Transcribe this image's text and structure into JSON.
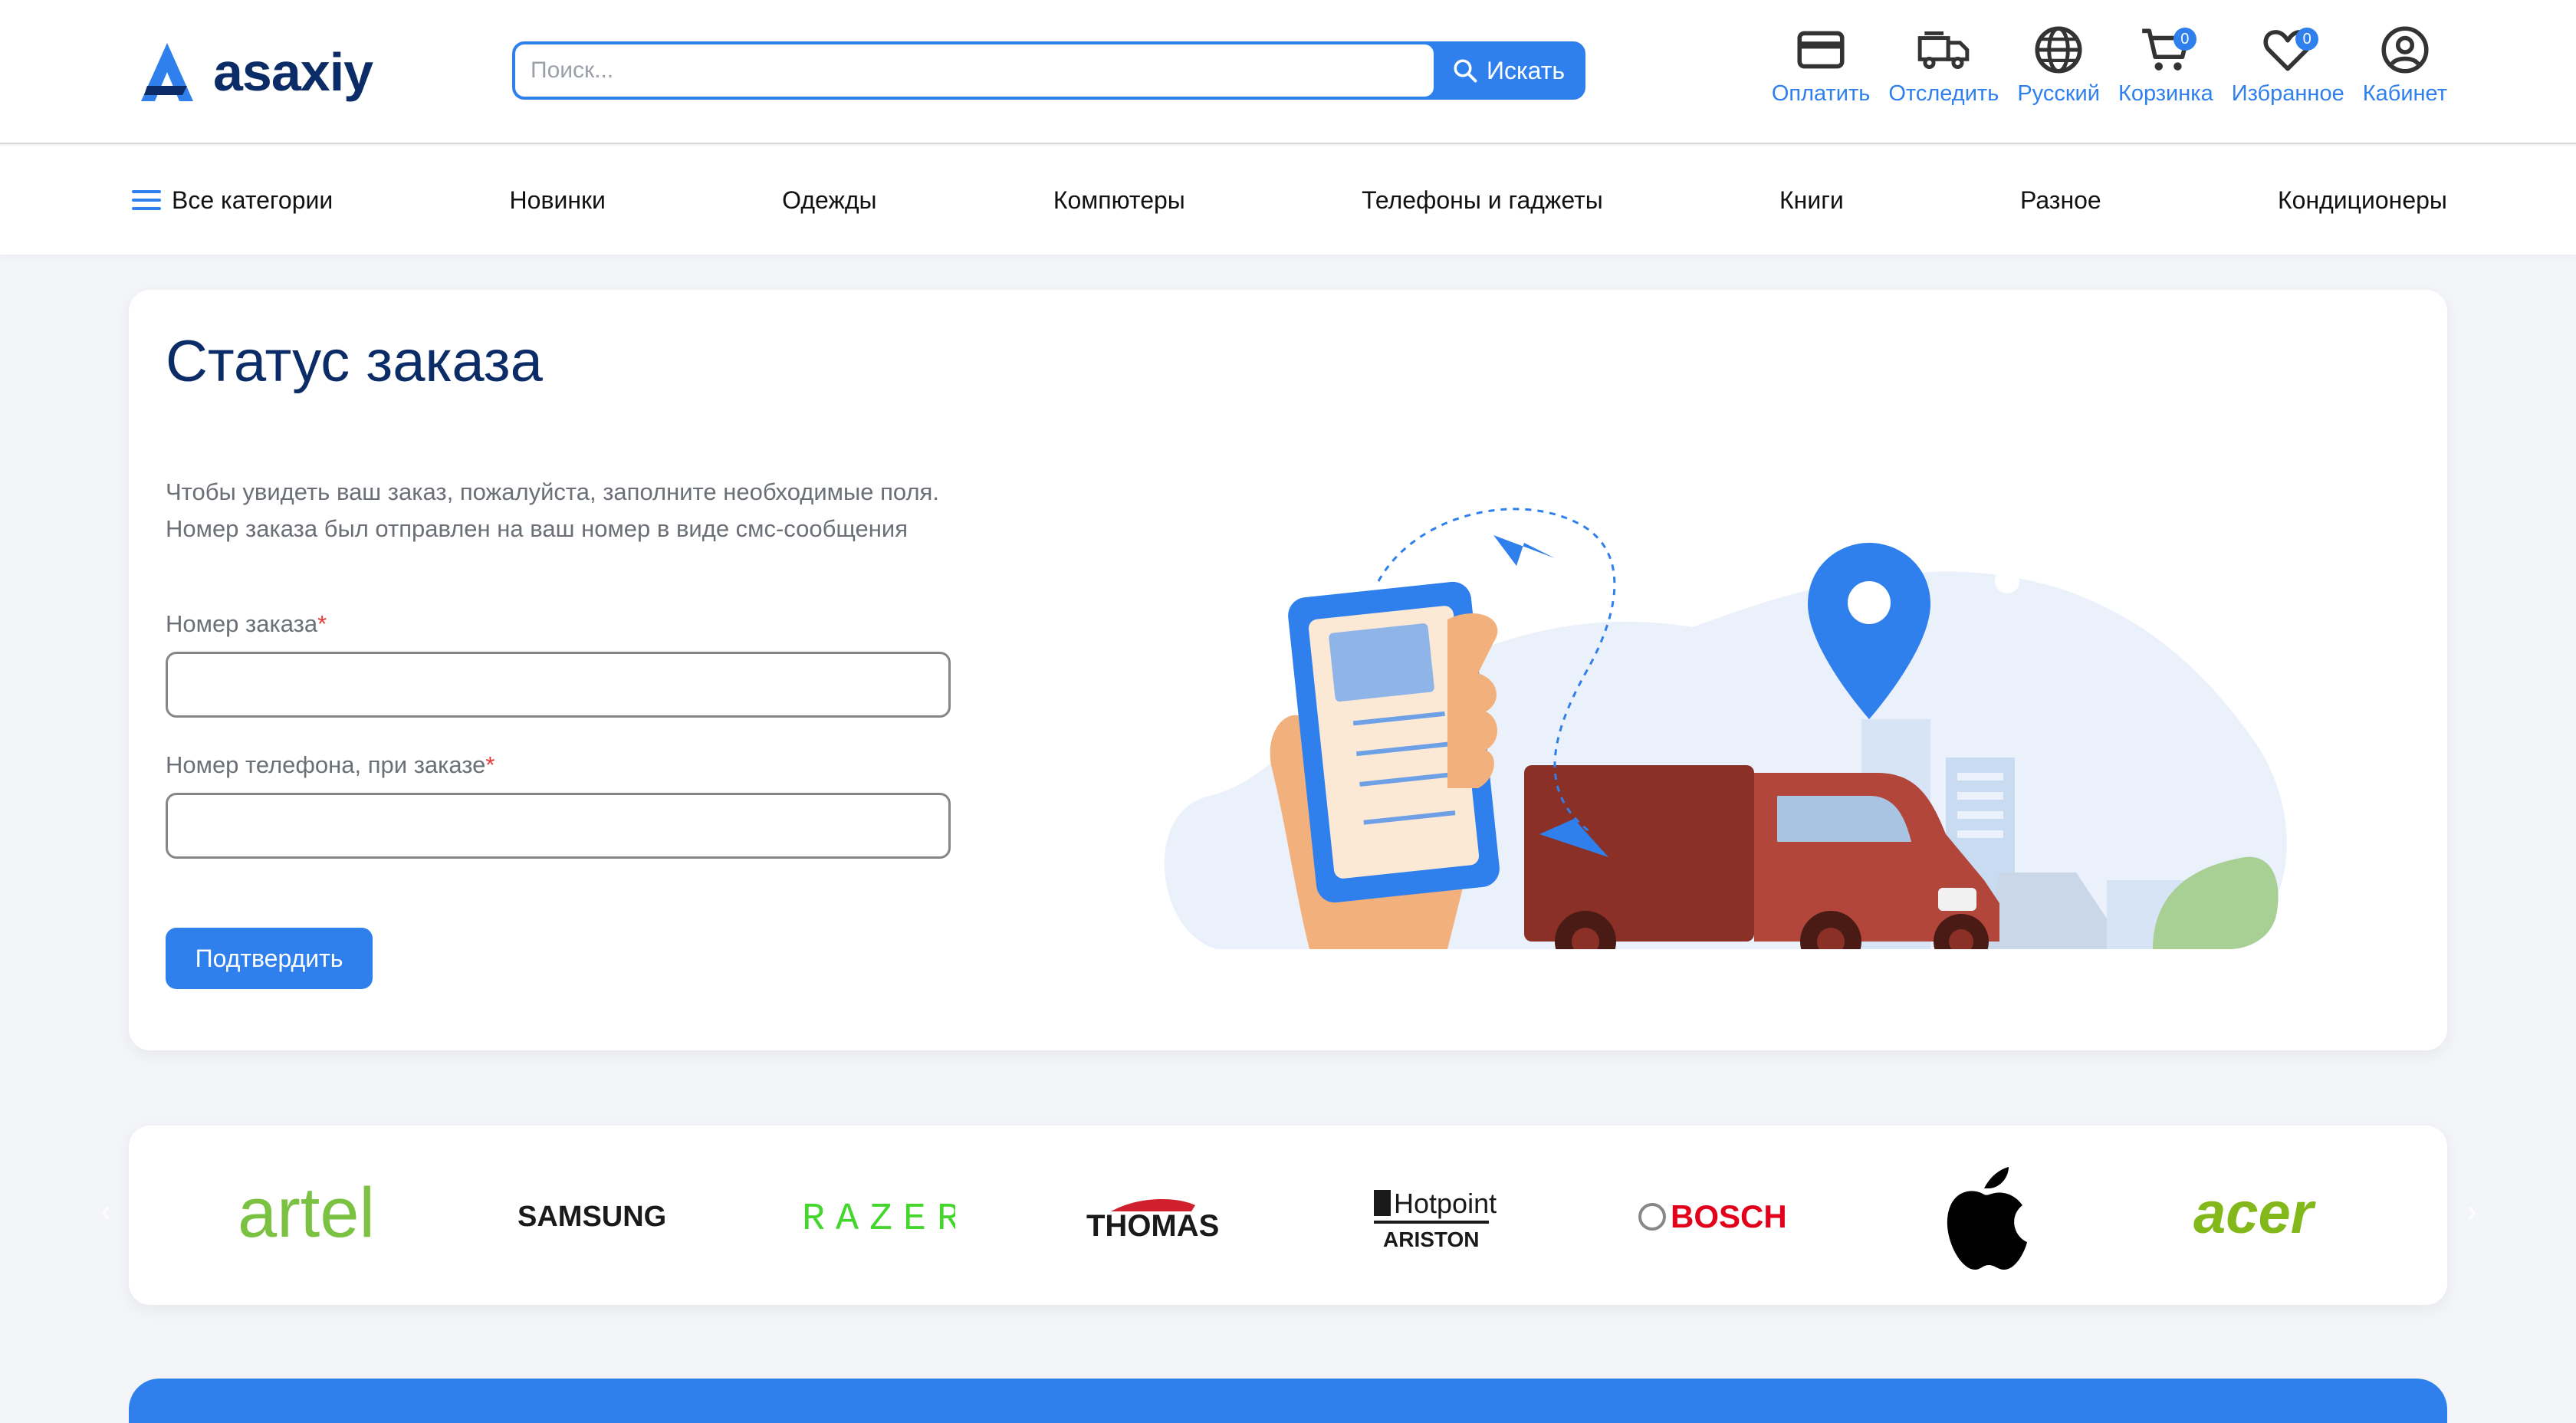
{
  "header": {
    "logo_text": "asaxiy",
    "search_placeholder": "Поиск...",
    "search_button": "Искать",
    "actions": [
      {
        "label": "Оплатить",
        "icon": "card-icon"
      },
      {
        "label": "Отследить",
        "icon": "truck-icon"
      },
      {
        "label": "Русский",
        "icon": "globe-icon"
      },
      {
        "label": "Корзинка",
        "icon": "cart-icon",
        "badge": "0"
      },
      {
        "label": "Избранное",
        "icon": "heart-icon",
        "badge": "0"
      },
      {
        "label": "Кабинет",
        "icon": "user-icon"
      }
    ]
  },
  "nav": {
    "items": [
      "Все категории",
      "Новинки",
      "Одежды",
      "Компютеры",
      "Телефоны и гаджеты",
      "Книги",
      "Разное",
      "Кондиционеры"
    ]
  },
  "order": {
    "title": "Статус заказа",
    "description": "Чтобы увидеть ваш заказ, пожалуйста, заполните необходимые поля. Номер заказа был отправлен на ваш номер в виде смс-сообщения",
    "order_label": "Номер заказа",
    "phone_label": "Номер телефона, при заказе",
    "required_mark": "*",
    "order_value": "",
    "phone_value": "",
    "submit": "Подтвердить"
  },
  "brands": {
    "items": [
      "artel",
      "SAMSUNG",
      "RAZER",
      "THOMAS",
      "Hotpoint",
      "ARISTON",
      "BOSCH",
      "acer"
    ]
  },
  "colors": {
    "accent": "#2f80ed",
    "title": "#0b2c66",
    "required": "#e53935",
    "artel": "#7bc242",
    "razer": "#44d62c",
    "bosch": "#e2001a"
  }
}
